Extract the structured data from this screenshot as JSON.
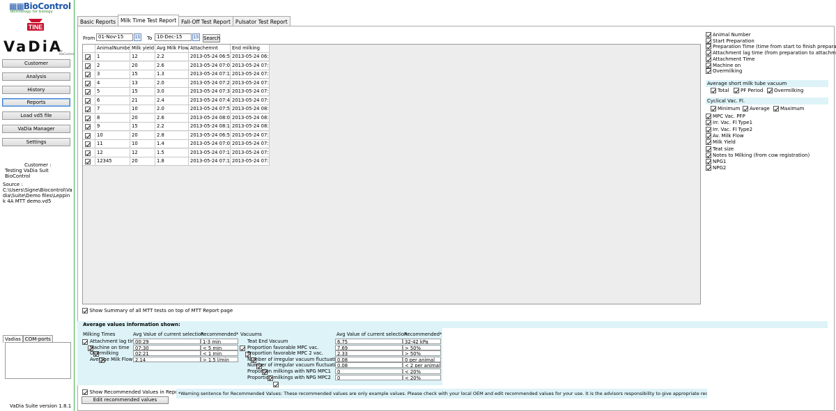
{
  "brand": {
    "biocontrol": "BioControl",
    "biocontrol_sub": "Technology for biology",
    "tine": "TINE",
    "vadia": "VaDiA",
    "vadia_sub": "by BioControl"
  },
  "nav": {
    "items": [
      "Customer",
      "Analysis",
      "History",
      "Reports",
      "Load vd5 file",
      "VaDia Manager",
      "Settings"
    ],
    "active": "Reports"
  },
  "left_info": {
    "customer_label": "Customer :",
    "customer_value": "Testing VaDia Suit BioControl",
    "source_label": "Source :",
    "source_value": "C:\\Users\\Signe\\Biocontrol\\Vadia\\Suite\\Demo files\\Leppink 4A MTT demo.vd5",
    "tabs": [
      "Vadias",
      "COM-ports"
    ],
    "version": "VaDia Suite version 1.8.1"
  },
  "tabs": [
    "Basic Reports",
    "Milk Time Test Report",
    "Fall-Off Test Report",
    "Pulsator Test Report"
  ],
  "selected_tab": "Milk Time Test Report",
  "filter": {
    "from_label": "From",
    "from_value": "01-Nov-15",
    "to_label": "To",
    "to_value": "10-Dec-15",
    "calendar_icon": "15",
    "search_label": "Search"
  },
  "grid": {
    "columns": [
      "AnimalNumber",
      "Milk yield",
      "Avg Milk Flow",
      "Attachemnt",
      "End milking"
    ],
    "rows": [
      [
        "1",
        "12",
        "2.2",
        "2013-05-24 06:50",
        "2013-05-24 06:56"
      ],
      [
        "2",
        "20",
        "2.6",
        "2013-05-24 07:00",
        "2013-05-24 07:08"
      ],
      [
        "3",
        "15",
        "1.3",
        "2013-05-24 07:10",
        "2013-05-24 07:21"
      ],
      [
        "4",
        "13",
        "2.0",
        "2013-05-24 07:24",
        "2013-05-24 07:31"
      ],
      [
        "5",
        "15",
        "3.0",
        "2013-05-24 07:33",
        "2013-05-24 07:38"
      ],
      [
        "6",
        "21",
        "2.4",
        "2013-05-24 07:44",
        "2013-05-24 07:53"
      ],
      [
        "7",
        "10",
        "2.0",
        "2013-05-24 07:55",
        "2013-05-24 08:00"
      ],
      [
        "8",
        "20",
        "2.6",
        "2013-05-24 08:03",
        "2013-05-24 08:11"
      ],
      [
        "9",
        "15",
        "2.2",
        "2013-05-24 08:13",
        "2013-05-24 08:20"
      ],
      [
        "10",
        "20",
        "2.8",
        "2013-05-24 06:58",
        "2013-05-24 07:06"
      ],
      [
        "11",
        "10",
        "1.4",
        "2013-05-24 07:09",
        "2013-05-24 07:16"
      ],
      [
        "12",
        "12",
        "1.5",
        "2013-05-24 07:18",
        "2013-05-24 07:26"
      ],
      [
        "12345",
        "20",
        "1.8",
        "2013-05-24 07:10",
        "2013-05-24 07:21"
      ]
    ]
  },
  "right_options": {
    "top": [
      "Animal Number",
      "Start Preparation",
      "Preparation Time (time from start to finish preparation)",
      "Attachment lag time (from preparation to attachment)",
      "Attachment Time",
      "Machine on",
      "Overmilking"
    ],
    "short_tube_header": "Average short milk tube vacuum",
    "short_tube": [
      "Total",
      "PF Period",
      "Overmilking"
    ],
    "cyclical_header": "Cyclical Vac. Fl.",
    "cyclical": [
      "Minimum",
      "Average",
      "Maximum"
    ],
    "bottom": [
      "MPC Vac. PFP",
      "Irr. Vac. Fl Type1",
      "Irr. Vac. Fl Type2",
      "Av. Milk Flow",
      "Milk Yield",
      "Teat size",
      "Notes to Milking (from cow registration)",
      "NPG1",
      "NPG2"
    ]
  },
  "summary": {
    "show_summary_label": "Show Summary of all MTT tests on top of MTT Report page",
    "avg_header": "Average values information shown:",
    "milking": {
      "col_headers": [
        "Milking Times",
        "Avg Value of current selection",
        "Recommended*"
      ],
      "rows": [
        [
          "Attachment lag time",
          "00:29",
          "1-3 min"
        ],
        [
          "Machine on time",
          "07:30",
          "< 5 min"
        ],
        [
          "Overmilking",
          "02:21",
          "< 1 min"
        ],
        [
          "Average Milk Flow",
          "2.14",
          "> 1.5 l/min"
        ]
      ]
    },
    "vacuums": {
      "col_headers": [
        "Vacuums",
        "Avg Value of current selection",
        "Recommended*"
      ],
      "rows": [
        [
          "Teat End Vacuum",
          "6.75",
          "32-42 kPa"
        ],
        [
          "Proportion favorable MPC vac.",
          "7.69",
          "> 50%"
        ],
        [
          "Proportion favorable MPC 2 vac.",
          "2.33",
          "> 50%"
        ],
        [
          "Number of irregular vacuum fluctuations",
          "0.08",
          "0 per animal"
        ],
        [
          "Number of irregular vacuum fluctuations2",
          "0.08",
          "< 2 per animal"
        ],
        [
          "Proportion milkings with NPG MPC1",
          "0",
          "< 20%"
        ],
        [
          "Proportion milkings with NPG MPC2",
          "0",
          "< 20%"
        ]
      ]
    },
    "show_recommended_label": "Show Recommended Values in Report",
    "edit_button": "Edit recommended values",
    "warning": "*Warning sentence for Recommended Values: These recommended values are only example values. Please check with your local OEM and edit recommended values for your use. It is the advisors responsibility to give appropriate recommendations."
  }
}
